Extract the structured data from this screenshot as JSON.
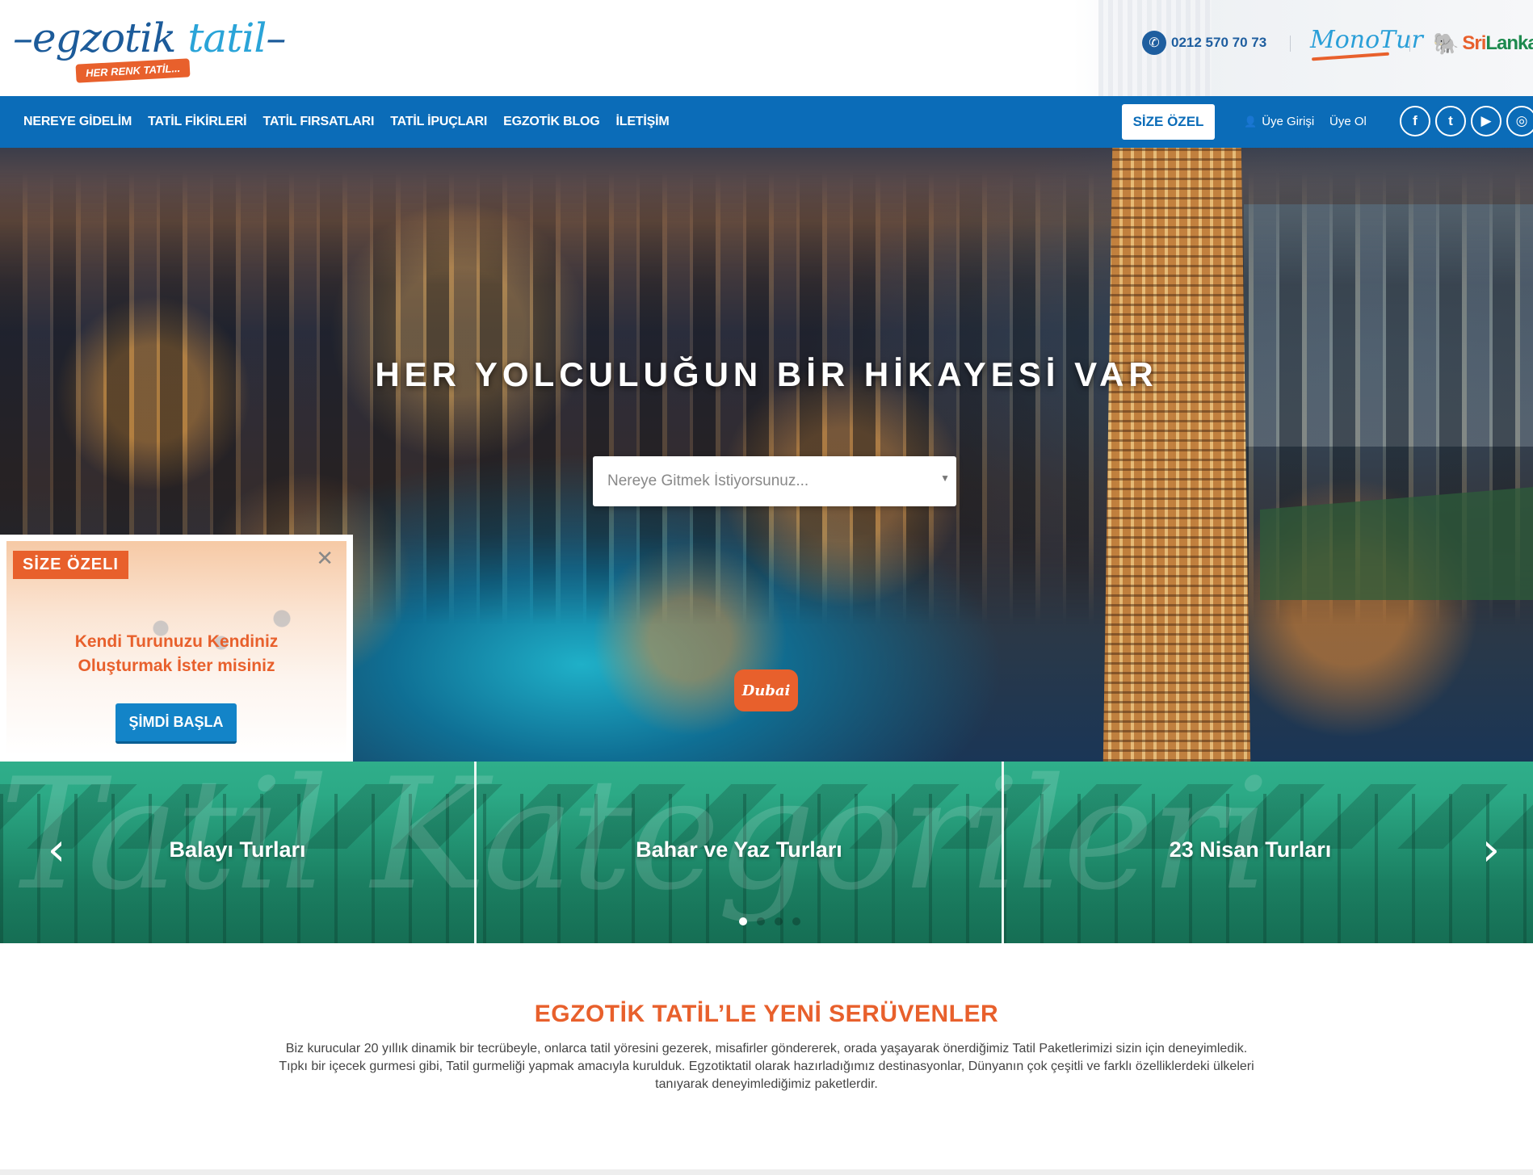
{
  "header": {
    "logo": {
      "word_a": "egzotik",
      "word_b": " tatil",
      "tagline": "HER RENK TATİL..."
    },
    "phone": "0212 570 70 73",
    "partner_monotur": "MonoTur",
    "partner_srilanka_a": "Sri",
    "partner_srilanka_b": "Lanka"
  },
  "nav": {
    "items": [
      "NEREYE GİDELİM",
      "TATİL FİKİRLERİ",
      "TATİL FIRSATLARI",
      "TATİL İPUÇLARI",
      "EGZOTİK BLOG",
      "İLETİŞİM"
    ],
    "special_button": "SİZE ÖZEL",
    "login": "Üye Girişi",
    "signup": "Üye Ol",
    "social": [
      {
        "name": "facebook-icon",
        "glyph": "f"
      },
      {
        "name": "twitter-icon",
        "glyph": "t"
      },
      {
        "name": "youtube-icon",
        "glyph": "▶"
      },
      {
        "name": "instagram-icon",
        "glyph": "◎"
      }
    ]
  },
  "hero": {
    "title": "HER YOLCULUĞUN BİR HİKAYESİ VAR",
    "search_placeholder": "Nereye Gitmek İstiyorsunuz...",
    "location_badge": "Dubai"
  },
  "promo": {
    "label": "SİZE ÖZELI",
    "message_line1": "Kendi Turunuzu Kendiniz",
    "message_line2": "Oluşturmak İster misiniz",
    "cta": "ŞİMDİ BAŞLA"
  },
  "categories": {
    "background_script": "Tatil Kategorileri",
    "items": [
      "Balayı Turları",
      "Bahar ve Yaz Turları",
      "23 Nisan Turları"
    ],
    "active_dot": 1,
    "dot_count": 4
  },
  "intro": {
    "title": "EGZOTİK TATİL’LE YENİ SERÜVENLER",
    "text_line1": "Biz kurucular 20 yıllık dinamik bir tecrübeyle, onlarca tatil yöresini gezerek, misafirler göndererek, orada yaşayarak önerdiğimiz Tatil Paketlerimizi sizin için deneyimledik.",
    "text_line2": "Tıpkı bir içecek gurmesi gibi, Tatil gurmeliği yapmak amacıyla kurulduk. Egzotiktatil olarak hazırladığımız destinasyonlar, Dünyanın çok çeşitli ve farklı özelliklerdeki ülkeleri",
    "text_line3": "tanıyarak deneyimlediğimiz paketlerdir."
  },
  "colors": {
    "brand_blue": "#0b6cb8",
    "accent_orange": "#e8602c",
    "category_green": "#25a07d"
  }
}
